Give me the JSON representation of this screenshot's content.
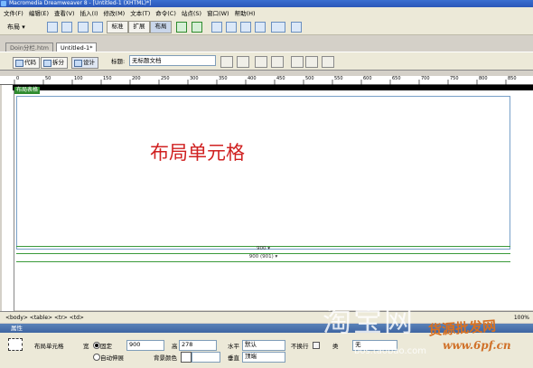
{
  "window": {
    "title": "Macromedia Dreamweaver 8 - [Untitled-1 (XHTML)*]"
  },
  "menubar": [
    "文件(F)",
    "编辑(E)",
    "查看(V)",
    "插入(I)",
    "修改(M)",
    "文本(T)",
    "命令(C)",
    "站点(S)",
    "窗口(W)",
    "帮助(H)"
  ],
  "insertbar": {
    "category": "布局",
    "buttons": [
      "标准",
      "扩展",
      "布局"
    ]
  },
  "tabs": [
    "Doin分栏.htm",
    "Untitled-1*"
  ],
  "doc_toolbar": {
    "code": "代码",
    "split": "拆分",
    "design": "设计",
    "title_label": "标题:",
    "title_value": "无标题文档"
  },
  "ruler_ticks": [
    "0",
    "50",
    "100",
    "150",
    "200",
    "250",
    "300",
    "350",
    "400",
    "450",
    "500",
    "550",
    "600",
    "650",
    "700",
    "750",
    "800",
    "850",
    "900"
  ],
  "canvas": {
    "layout_table_tag": "布局表格",
    "cell_text": "布局单元格",
    "width_label_1": "900 ▾",
    "width_label_2": "900 (901) ▾"
  },
  "status": {
    "tags": "<body> <table> <tr> <td>",
    "zoom": "100%"
  },
  "properties": {
    "header": "属性",
    "cell_label": "布局单元格",
    "width_label": "宽",
    "fixed_label": "固定",
    "fixed_value": "900",
    "auto_label": "自动伸展",
    "height_label": "高",
    "height_value": "278",
    "bg_label": "背景颜色",
    "h_align_label": "水平",
    "h_align_value": "默认",
    "v_align_label": "垂直",
    "v_align_value": "顶端",
    "nowrap_label": "不换行",
    "class_label": "类",
    "class_value": "无"
  },
  "watermarks": {
    "taobao": "淘宝网",
    "taobao_url": "bos.taobao.com",
    "site_cn": "货源批发网",
    "site_url": "www.6pf.cn"
  }
}
